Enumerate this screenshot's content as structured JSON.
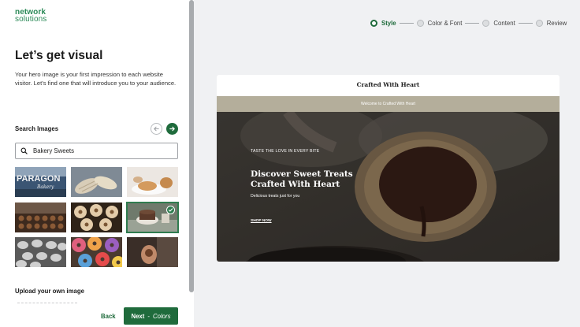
{
  "brand": {
    "line1": "network",
    "line2": "solutions"
  },
  "left": {
    "title": "Let’s get visual",
    "description": "Your hero image is your first impression to each website visitor. Let’s find one that will introduce you to your audience.",
    "search_label": "Search Images",
    "search_value": "Bakery Sweets",
    "selected_index": 5,
    "upload_label": "Upload your own image",
    "back_label": "Back",
    "next_label": "Next",
    "next_separator": "-",
    "next_target": "Colors"
  },
  "stepper": {
    "steps": [
      {
        "label": "Style",
        "active": true
      },
      {
        "label": "Color & Font",
        "active": false
      },
      {
        "label": "Content",
        "active": false
      },
      {
        "label": "Review",
        "active": false
      }
    ]
  },
  "preview": {
    "site_title": "Crafted With Heart",
    "banner": "Welcome to Crafted With Heart",
    "tagline": "TASTE THE LOVE IN EVERY BITE",
    "headline": "Discover Sweet Treats Crafted With Heart",
    "subtext": "Delicious treats just for you",
    "cta": "SHOP NOW"
  },
  "tiles": [
    {
      "name": "paragon-bakery-sign",
      "text": "PARAGON"
    },
    {
      "name": "bread-loaves"
    },
    {
      "name": "pastry-plate"
    },
    {
      "name": "chocolate-tray"
    },
    {
      "name": "sugar-donuts"
    },
    {
      "name": "cake-on-table"
    },
    {
      "name": "monochrome-macarons"
    },
    {
      "name": "colorful-donuts"
    },
    {
      "name": "hand-with-cookie"
    }
  ],
  "colors": {
    "brand_green": "#1f6b3c",
    "accent_green": "#2c8a58"
  }
}
